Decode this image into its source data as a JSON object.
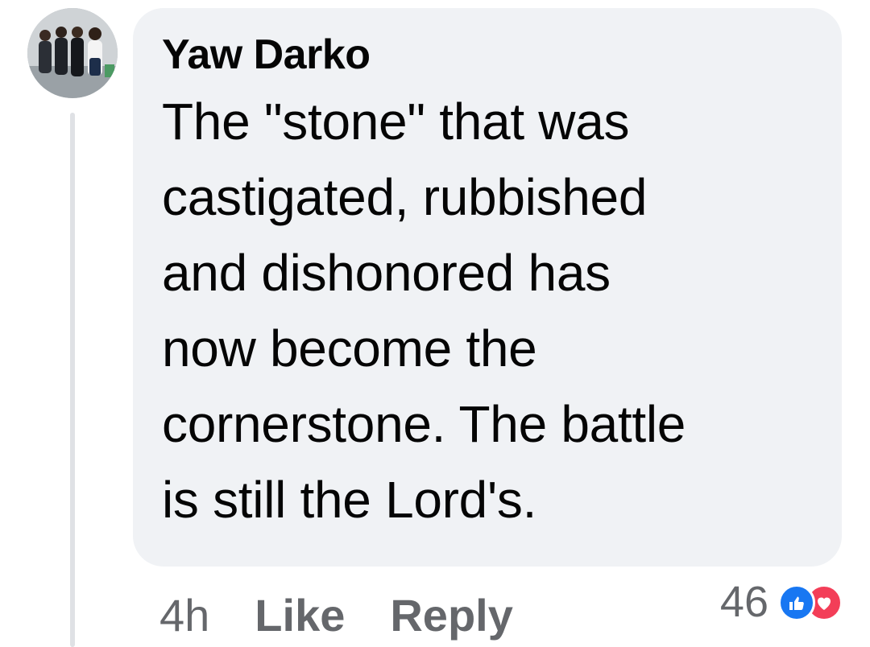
{
  "comment": {
    "author": "Yaw Darko",
    "lines": [
      "The \"stone\" that was",
      "castigated, rubbished",
      "and dishonored has",
      "now become the",
      "cornerstone. The battle",
      "is still the Lord's."
    ]
  },
  "actions": {
    "time": "4h",
    "like_label": "Like",
    "reply_label": "Reply"
  },
  "reactions": {
    "count": "46",
    "icons": [
      "like-icon",
      "love-icon"
    ]
  },
  "colors": {
    "bubble": "#f0f2f5",
    "text": "#050505",
    "secondary": "#65676b",
    "like": "#1877f2",
    "love": "#f33e58"
  }
}
